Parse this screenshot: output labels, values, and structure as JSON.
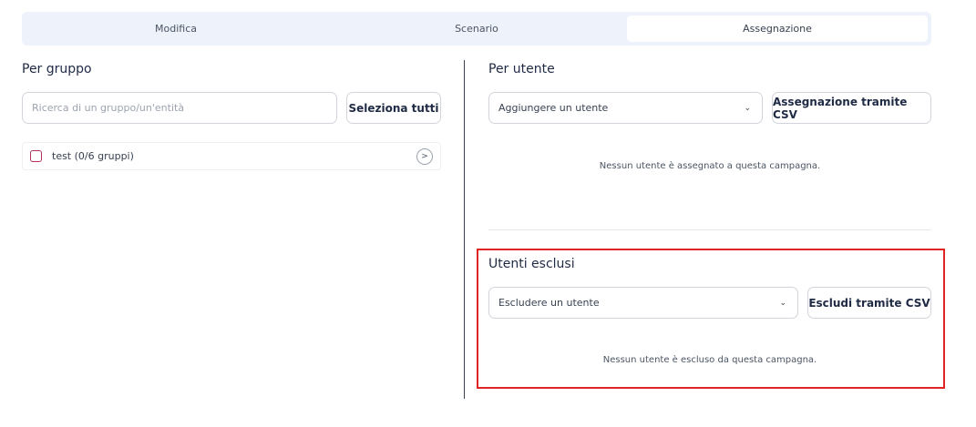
{
  "tabs": [
    {
      "label": "Modifica",
      "active": false
    },
    {
      "label": "Scenario",
      "active": false
    },
    {
      "label": "Assegnazione",
      "active": true
    }
  ],
  "per_gruppo": {
    "title": "Per gruppo",
    "search_placeholder": "Ricerca di un gruppo/un'entità",
    "select_all_label": "Seleziona tutti",
    "groups": [
      {
        "label": "test (0/6 gruppi)",
        "checked": false
      }
    ]
  },
  "per_utente": {
    "title": "Per utente",
    "add_user_select": "Aggiungere un utente",
    "csv_button_label": "Assegnazione tramite CSV",
    "empty_message": "Nessun utente è assegnato a questa campagna."
  },
  "utenti_esclusi": {
    "title": "Utenti esclusi",
    "exclude_user_select": "Escludere un utente",
    "csv_button_label": "Escludi tramite CSV",
    "empty_message": "Nessun utente è escluso da questa campagna."
  },
  "icons": {
    "select_chevron": "chevron-down-icon",
    "group_expand": "chevron-right-icon"
  },
  "colors": {
    "tab_bar_bg": "#eef2fb",
    "highlight_border": "#e02424",
    "checkbox_border": "#b0305a"
  }
}
